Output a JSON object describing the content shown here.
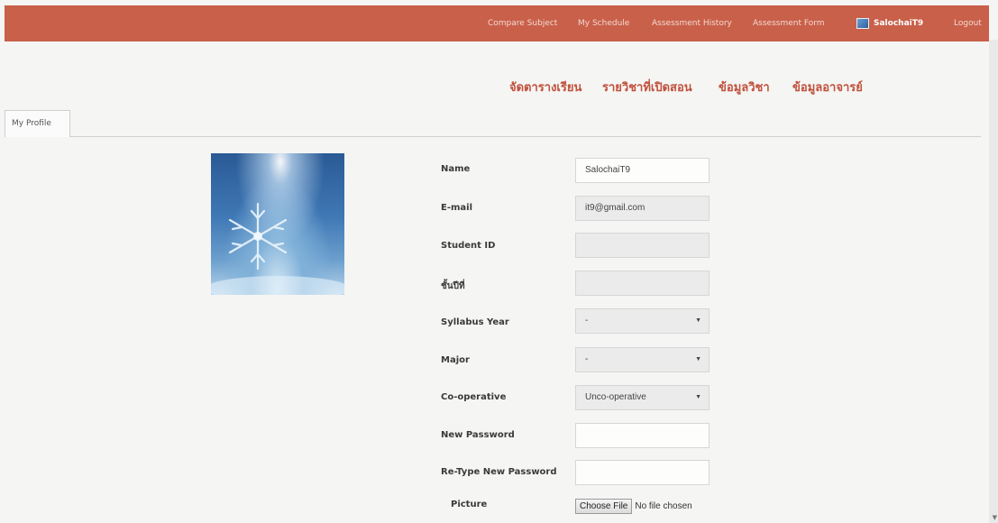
{
  "topbar": {
    "links": [
      "Compare Subject",
      "My Schedule",
      "Assessment History",
      "Assessment Form"
    ],
    "user": "SalochaiT9",
    "logout": "Logout",
    "color": "#c9604a"
  },
  "thai_nav": [
    "จัดตารางเรียน",
    "รายวิชาที่เปิดสอน",
    "ข้อมูลวิชา",
    "ข้อมูลอาจารย์"
  ],
  "tab": {
    "label": "My Profile"
  },
  "form": {
    "labels": {
      "name": "Name",
      "email": "E-mail",
      "student_id": "Student ID",
      "year": "ชั้นปีที่",
      "syllabus": "Syllabus Year",
      "major": "Major",
      "coop": "Co-operative",
      "new_password": "New Password",
      "retype_password": "Re-Type New Password",
      "picture": "Picture"
    },
    "values": {
      "name": "SalochaiT9",
      "email": "it9@gmail.com",
      "student_id": "",
      "year": "",
      "syllabus": "-",
      "major": "-",
      "coop": "Unco-operative",
      "new_password": "",
      "retype_password": ""
    },
    "file_button": "Choose File",
    "file_status": "No file chosen"
  }
}
